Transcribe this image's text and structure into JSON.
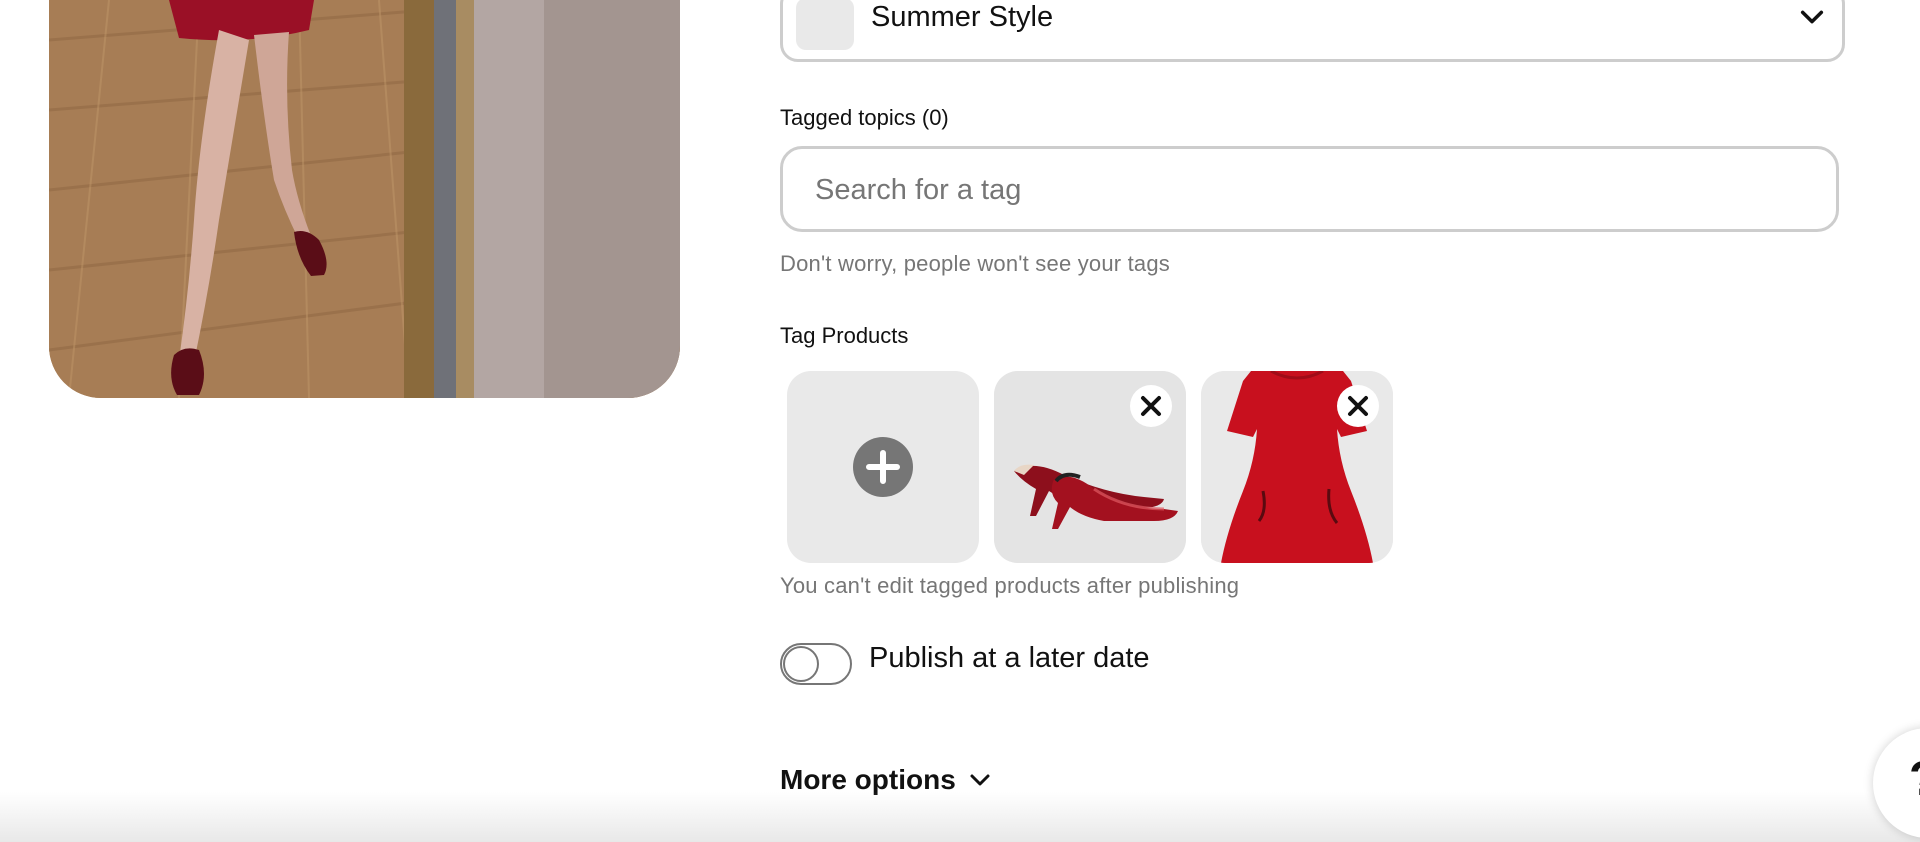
{
  "board": {
    "name": "Summer Style",
    "chevron_icon": "chevron-down-icon"
  },
  "tagged_topics": {
    "label": "Tagged topics (0)",
    "placeholder": "Search for a tag",
    "value": "",
    "helper": "Don't worry, people won't see your tags"
  },
  "tag_products": {
    "label": "Tag Products",
    "add_icon": "plus-circle-icon",
    "remove_icon": "close-icon",
    "products": [
      {
        "name": "red slingback kitten heels"
      },
      {
        "name": "red short-sleeve mini dress"
      }
    ],
    "helper": "You can't edit tagged products after publishing"
  },
  "publish_later": {
    "label": "Publish at a later date",
    "enabled": false
  },
  "more_options": {
    "label": "More options",
    "icon": "chevron-down-icon"
  },
  "help": {
    "glyph": "?"
  },
  "colors": {
    "field_border": "#cdcdcd",
    "tile_bg": "#e9e9e9",
    "helper_text": "#767676",
    "text": "#111111"
  }
}
